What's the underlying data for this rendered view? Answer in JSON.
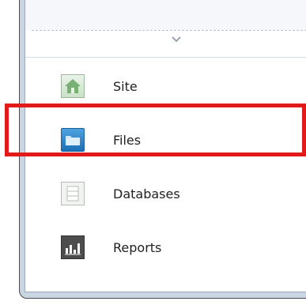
{
  "navigation": {
    "items": [
      {
        "label": "Site",
        "icon": "site-home-icon"
      },
      {
        "label": "Files",
        "icon": "folder-icon"
      },
      {
        "label": "Databases",
        "icon": "database-icon"
      },
      {
        "label": "Reports",
        "icon": "reports-chart-icon"
      }
    ],
    "selected": "Files"
  },
  "colors": {
    "highlight": "#e21a1a",
    "files_icon": "#2b82cc",
    "site_icon": "#7fb27a"
  }
}
